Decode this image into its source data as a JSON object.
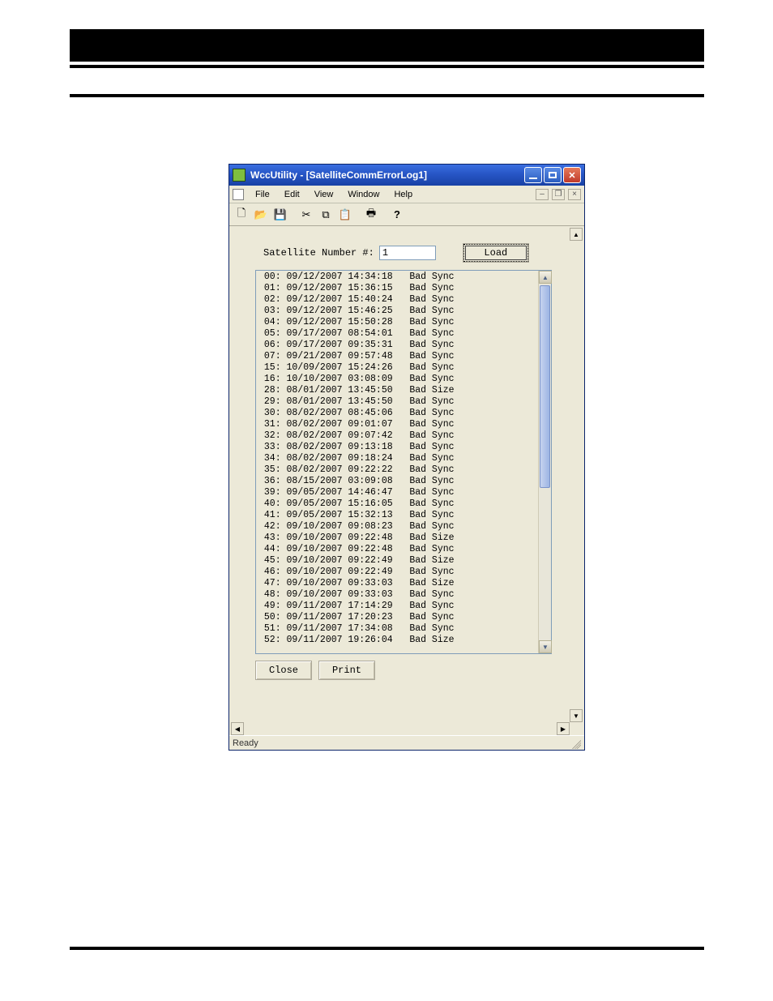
{
  "window": {
    "title": "WccUtility - [SatelliteCommErrorLog1]"
  },
  "menu": {
    "items": [
      "File",
      "Edit",
      "View",
      "Window",
      "Help"
    ]
  },
  "form": {
    "label": "Satellite Number #:",
    "value": "1",
    "load": "Load"
  },
  "log": [
    {
      "idx": "00",
      "date": "09/12/2007",
      "time": "14:34:18",
      "err": "Bad Sync"
    },
    {
      "idx": "01",
      "date": "09/12/2007",
      "time": "15:36:15",
      "err": "Bad Sync"
    },
    {
      "idx": "02",
      "date": "09/12/2007",
      "time": "15:40:24",
      "err": "Bad Sync"
    },
    {
      "idx": "03",
      "date": "09/12/2007",
      "time": "15:46:25",
      "err": "Bad Sync"
    },
    {
      "idx": "04",
      "date": "09/12/2007",
      "time": "15:50:28",
      "err": "Bad Sync"
    },
    {
      "idx": "05",
      "date": "09/17/2007",
      "time": "08:54:01",
      "err": "Bad Sync"
    },
    {
      "idx": "06",
      "date": "09/17/2007",
      "time": "09:35:31",
      "err": "Bad Sync"
    },
    {
      "idx": "07",
      "date": "09/21/2007",
      "time": "09:57:48",
      "err": "Bad Sync"
    },
    {
      "idx": "15",
      "date": "10/09/2007",
      "time": "15:24:26",
      "err": "Bad Sync"
    },
    {
      "idx": "16",
      "date": "10/10/2007",
      "time": "03:08:09",
      "err": "Bad Sync"
    },
    {
      "idx": "28",
      "date": "08/01/2007",
      "time": "13:45:50",
      "err": "Bad Size"
    },
    {
      "idx": "29",
      "date": "08/01/2007",
      "time": "13:45:50",
      "err": "Bad Sync"
    },
    {
      "idx": "30",
      "date": "08/02/2007",
      "time": "08:45:06",
      "err": "Bad Sync"
    },
    {
      "idx": "31",
      "date": "08/02/2007",
      "time": "09:01:07",
      "err": "Bad Sync"
    },
    {
      "idx": "32",
      "date": "08/02/2007",
      "time": "09:07:42",
      "err": "Bad Sync"
    },
    {
      "idx": "33",
      "date": "08/02/2007",
      "time": "09:13:18",
      "err": "Bad Sync"
    },
    {
      "idx": "34",
      "date": "08/02/2007",
      "time": "09:18:24",
      "err": "Bad Sync"
    },
    {
      "idx": "35",
      "date": "08/02/2007",
      "time": "09:22:22",
      "err": "Bad Sync"
    },
    {
      "idx": "36",
      "date": "08/15/2007",
      "time": "03:09:08",
      "err": "Bad Sync"
    },
    {
      "idx": "39",
      "date": "09/05/2007",
      "time": "14:46:47",
      "err": "Bad Sync"
    },
    {
      "idx": "40",
      "date": "09/05/2007",
      "time": "15:16:05",
      "err": "Bad Sync"
    },
    {
      "idx": "41",
      "date": "09/05/2007",
      "time": "15:32:13",
      "err": "Bad Sync"
    },
    {
      "idx": "42",
      "date": "09/10/2007",
      "time": "09:08:23",
      "err": "Bad Sync"
    },
    {
      "idx": "43",
      "date": "09/10/2007",
      "time": "09:22:48",
      "err": "Bad Size"
    },
    {
      "idx": "44",
      "date": "09/10/2007",
      "time": "09:22:48",
      "err": "Bad Sync"
    },
    {
      "idx": "45",
      "date": "09/10/2007",
      "time": "09:22:49",
      "err": "Bad Size"
    },
    {
      "idx": "46",
      "date": "09/10/2007",
      "time": "09:22:49",
      "err": "Bad Sync"
    },
    {
      "idx": "47",
      "date": "09/10/2007",
      "time": "09:33:03",
      "err": "Bad Size"
    },
    {
      "idx": "48",
      "date": "09/10/2007",
      "time": "09:33:03",
      "err": "Bad Sync"
    },
    {
      "idx": "49",
      "date": "09/11/2007",
      "time": "17:14:29",
      "err": "Bad Sync"
    },
    {
      "idx": "50",
      "date": "09/11/2007",
      "time": "17:20:23",
      "err": "Bad Sync"
    },
    {
      "idx": "51",
      "date": "09/11/2007",
      "time": "17:34:08",
      "err": "Bad Sync"
    },
    {
      "idx": "52",
      "date": "09/11/2007",
      "time": "19:26:04",
      "err": "Bad Size"
    }
  ],
  "buttons": {
    "close": "Close",
    "print": "Print"
  },
  "status": "Ready"
}
